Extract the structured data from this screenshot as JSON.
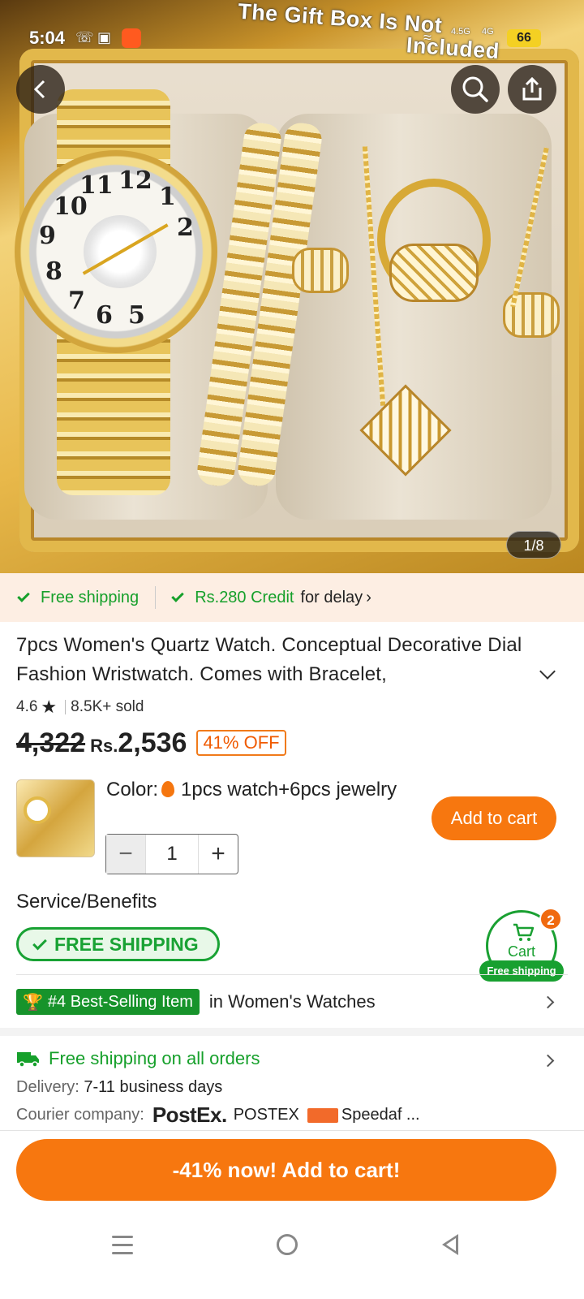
{
  "status_bar": {
    "time": "5:04",
    "battery": "66",
    "network_1": "4.5G",
    "network_2": "4G"
  },
  "hero": {
    "overlay_text_1": "The Gift Box Is Not",
    "overlay_text_2": "Included",
    "image_counter": "1/8",
    "watch_numbers": [
      "12",
      "1",
      "2",
      "11",
      "10",
      "9",
      "8",
      "7",
      "6",
      "5"
    ]
  },
  "shipping_strip": {
    "free_shipping": "Free shipping",
    "credit_amount": "Rs.280 Credit",
    "credit_suffix": "for delay"
  },
  "product": {
    "title": "7pcs Women's Quartz Watch. Conceptual Decorative Dial Fashion Wristwatch. Comes with Bracelet,",
    "rating": "4.6",
    "sold": "8.5K+ sold",
    "old_price": "4,322",
    "currency": "Rs.",
    "price": "2,536",
    "discount": "41% OFF"
  },
  "variant": {
    "color_label": "Color:",
    "color_value": "1pcs watch+6pcs jewelry",
    "quantity": "1",
    "add_to_cart": "Add to cart"
  },
  "service": {
    "title": "Service/Benefits",
    "free_shipping_badge": "FREE SHIPPING"
  },
  "floating_cart": {
    "label": "Cart",
    "count": "2",
    "free_shipping": "Free shipping"
  },
  "ranking": {
    "badge": "#4 Best-Selling Item",
    "category": "in Women's Watches"
  },
  "delivery_info": {
    "title": "Free shipping on all orders",
    "delivery_label": "Delivery:",
    "delivery_value": "7-11 business days",
    "courier_label": "Courier company:",
    "courier_logo_1": "PostEx.",
    "courier_1": "POSTEX",
    "courier_2": "Speedaf ..."
  },
  "cta": {
    "label": "-41% now! Add to cart!"
  },
  "colors": {
    "accent_orange": "#f7770f",
    "green": "#16a02b"
  }
}
